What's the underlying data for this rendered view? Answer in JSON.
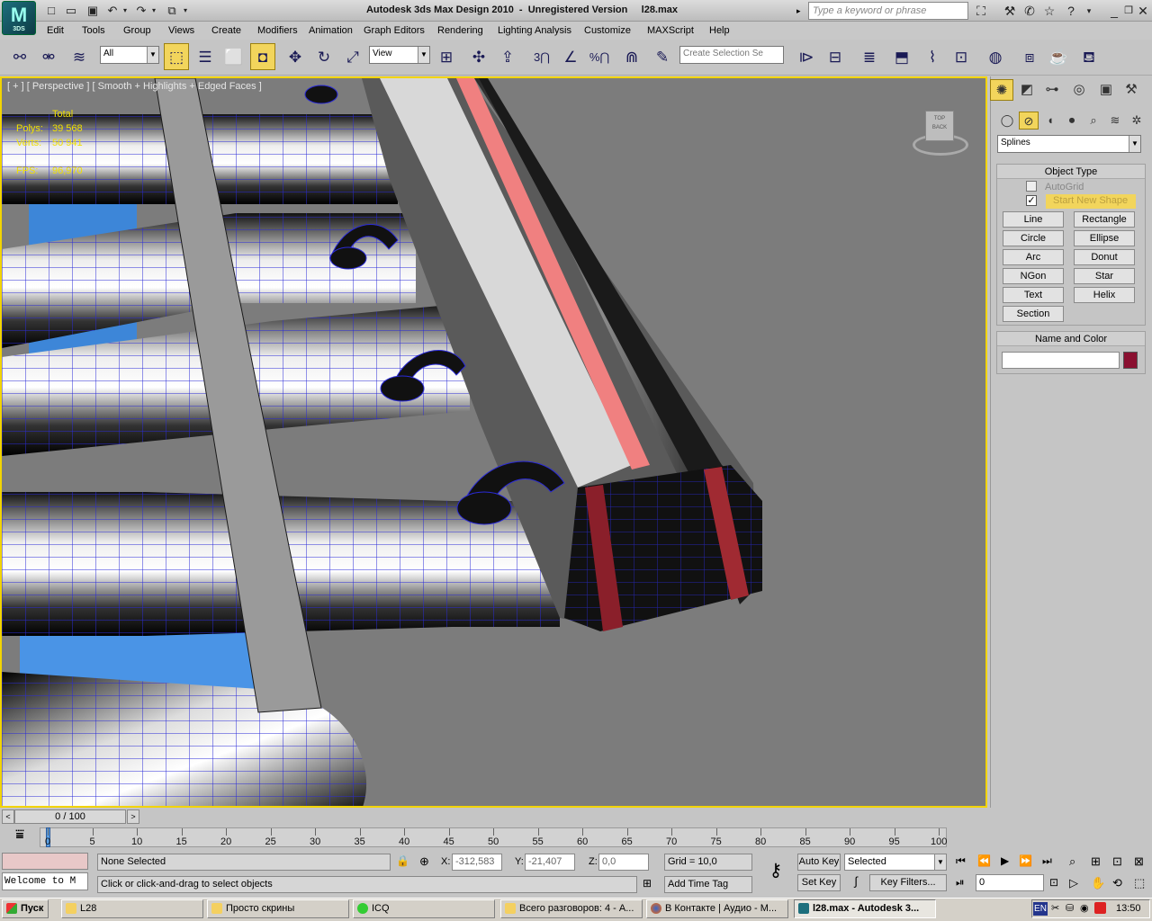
{
  "app": {
    "logo_text": "M",
    "logo_sub": "3DS",
    "title": "Autodesk 3ds Max Design 2010  -  Unregistered Version     l28.max"
  },
  "search": {
    "placeholder": "Type a keyword or phrase"
  },
  "menu": [
    "Edit",
    "Tools",
    "Group",
    "Views",
    "Create",
    "Modifiers",
    "Animation",
    "Graph Editors",
    "Rendering",
    "Lighting Analysis",
    "Customize",
    "MAXScript",
    "Help"
  ],
  "toolbar": {
    "filter": "All",
    "refcoord": "View",
    "snap3": "3",
    "percent": "%",
    "selset_placeholder": "Create Selection Se"
  },
  "viewport": {
    "label": "[ + ] [ Perspective ] [ Smooth + Highlights + Edged Faces ]",
    "stats": {
      "total_label": "Total",
      "polys_label": "Polys:",
      "polys": "39 568",
      "verts_label": "Verts:",
      "verts": "50 941",
      "fps_label": "FPS:",
      "fps": "96,970"
    },
    "viewcube": {
      "top": "TOP",
      "back": "BACK"
    }
  },
  "command_panel": {
    "category": "Splines",
    "object_type_title": "Object Type",
    "autogrid": "AutoGrid",
    "start_new_shape": "Start New Shape",
    "buttons": [
      "Line",
      "Rectangle",
      "Circle",
      "Ellipse",
      "Arc",
      "Donut",
      "NGon",
      "Star",
      "Text",
      "Helix",
      "Section"
    ],
    "name_color_title": "Name and Color",
    "swatch_color": "#8a1030"
  },
  "timeline": {
    "slider": "0 / 100",
    "ticks": [
      "0",
      "5",
      "10",
      "15",
      "20",
      "25",
      "30",
      "35",
      "40",
      "45",
      "50",
      "55",
      "60",
      "65",
      "70",
      "75",
      "80",
      "85",
      "90",
      "95",
      "100"
    ]
  },
  "status": {
    "maxscript": "Welcome to M",
    "selection": "None Selected",
    "prompt": "Click or click-and-drag to select objects",
    "x_label": "X:",
    "x": "-312,583",
    "y_label": "Y:",
    "y": "-21,407",
    "z_label": "Z:",
    "z": "0,0",
    "grid": "Grid = 10,0",
    "add_time_tag": "Add Time Tag",
    "auto_key": "Auto Key",
    "set_key": "Set Key",
    "selected": "Selected",
    "key_filters": "Key Filters...",
    "frame": "0"
  },
  "taskbar": {
    "start": "Пуск",
    "tasks": [
      "L28",
      "Просто скрины",
      "ICQ",
      "Всего разговоров: 4 - А...",
      "В Контакте | Аудио - М...",
      "l28.max - Autodesk 3..."
    ],
    "lang": "EN",
    "clock": "13:50"
  }
}
